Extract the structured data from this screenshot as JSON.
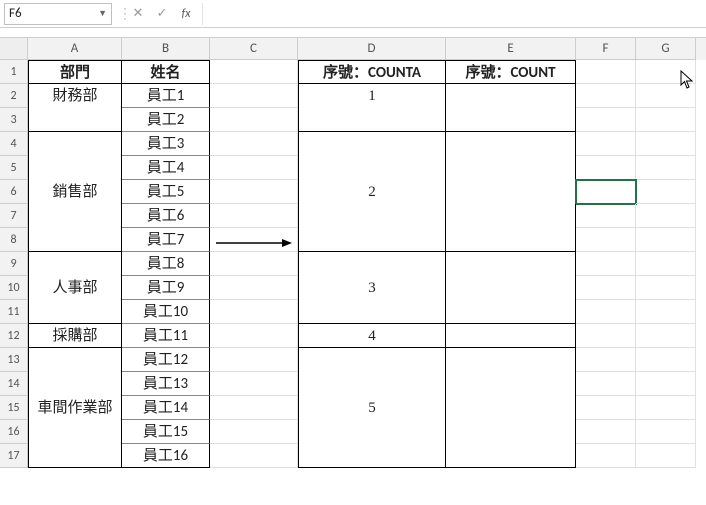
{
  "namebox": "F6",
  "fx_label": "fx",
  "columns": [
    "A",
    "B",
    "C",
    "D",
    "E",
    "F",
    "G"
  ],
  "rows": [
    "1",
    "2",
    "3",
    "4",
    "5",
    "6",
    "7",
    "8",
    "9",
    "10",
    "11",
    "12",
    "13",
    "14",
    "15",
    "16",
    "17"
  ],
  "header": {
    "dept": "部門",
    "name": "姓名",
    "d": "序號：COUNTA",
    "e": "序號：COUNT"
  },
  "deptGroups": [
    {
      "label": "財務部",
      "size": 2,
      "seq": "1"
    },
    {
      "label": "銷售部",
      "size": 5,
      "seq": "2"
    },
    {
      "label": "人事部",
      "size": 3,
      "seq": "3"
    },
    {
      "label": "採購部",
      "size": 1,
      "seq": "4"
    },
    {
      "label": "車間作業部",
      "size": 5,
      "seq": "5"
    }
  ],
  "employees": [
    "員工1",
    "員工2",
    "員工3",
    "員工4",
    "員工5",
    "員工6",
    "員工7",
    "員工8",
    "員工9",
    "員工10",
    "員工11",
    "員工12",
    "員工13",
    "員工14",
    "員工15",
    "員工16"
  ],
  "chart_data": {
    "type": "table",
    "title": "",
    "columns": [
      "部門",
      "姓名",
      "序號：COUNTA",
      "序號：COUNT"
    ],
    "rows": [
      [
        "財務部",
        "員工1",
        "1",
        ""
      ],
      [
        "財務部",
        "員工2",
        "1",
        ""
      ],
      [
        "銷售部",
        "員工3",
        "2",
        ""
      ],
      [
        "銷售部",
        "員工4",
        "2",
        ""
      ],
      [
        "銷售部",
        "員工5",
        "2",
        ""
      ],
      [
        "銷售部",
        "員工6",
        "2",
        ""
      ],
      [
        "銷售部",
        "員工7",
        "2",
        ""
      ],
      [
        "人事部",
        "員工8",
        "3",
        ""
      ],
      [
        "人事部",
        "員工9",
        "3",
        ""
      ],
      [
        "人事部",
        "員工10",
        "3",
        ""
      ],
      [
        "採購部",
        "員工11",
        "4",
        ""
      ],
      [
        "車間作業部",
        "員工12",
        "5",
        ""
      ],
      [
        "車間作業部",
        "員工13",
        "5",
        ""
      ],
      [
        "車間作業部",
        "員工14",
        "5",
        ""
      ],
      [
        "車間作業部",
        "員工15",
        "5",
        ""
      ],
      [
        "車間作業部",
        "員工16",
        "5",
        ""
      ]
    ]
  }
}
